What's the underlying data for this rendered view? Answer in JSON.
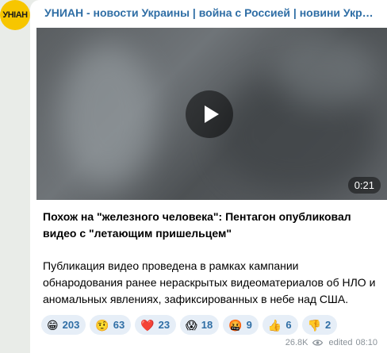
{
  "channel": {
    "name": "УНИАН - новости Украины | война с Россией | новини України...",
    "avatar_text": "УНІАН"
  },
  "video": {
    "duration": "0:21"
  },
  "post": {
    "headline": "Похож на \"железного человека\": Пентагон опубликовал видео с \"летающим пришельцем\"",
    "body": "Публикация видео проведена в рамках кампании обнародования ранее нераскрытых видеоматериалов об НЛО и аномальных явлениях, зафиксированных в небе над США."
  },
  "reactions": [
    {
      "emoji": "😁",
      "count": "203"
    },
    {
      "emoji": "🤨",
      "count": "63"
    },
    {
      "emoji": "❤️",
      "count": "23"
    },
    {
      "emoji": "😱",
      "count": "18"
    },
    {
      "emoji": "🤬",
      "count": "9"
    },
    {
      "emoji": "👍",
      "count": "6"
    },
    {
      "emoji": "👎",
      "count": "2"
    }
  ],
  "meta": {
    "views": "26.8K",
    "edited_label": "edited",
    "time": "08:10"
  },
  "colors": {
    "channel_name": "#2f6ea5",
    "avatar_bg": "#f7c600",
    "reaction_bg": "#e6eef7"
  },
  "icons": {
    "play": "play-icon",
    "views": "eye-icon"
  }
}
